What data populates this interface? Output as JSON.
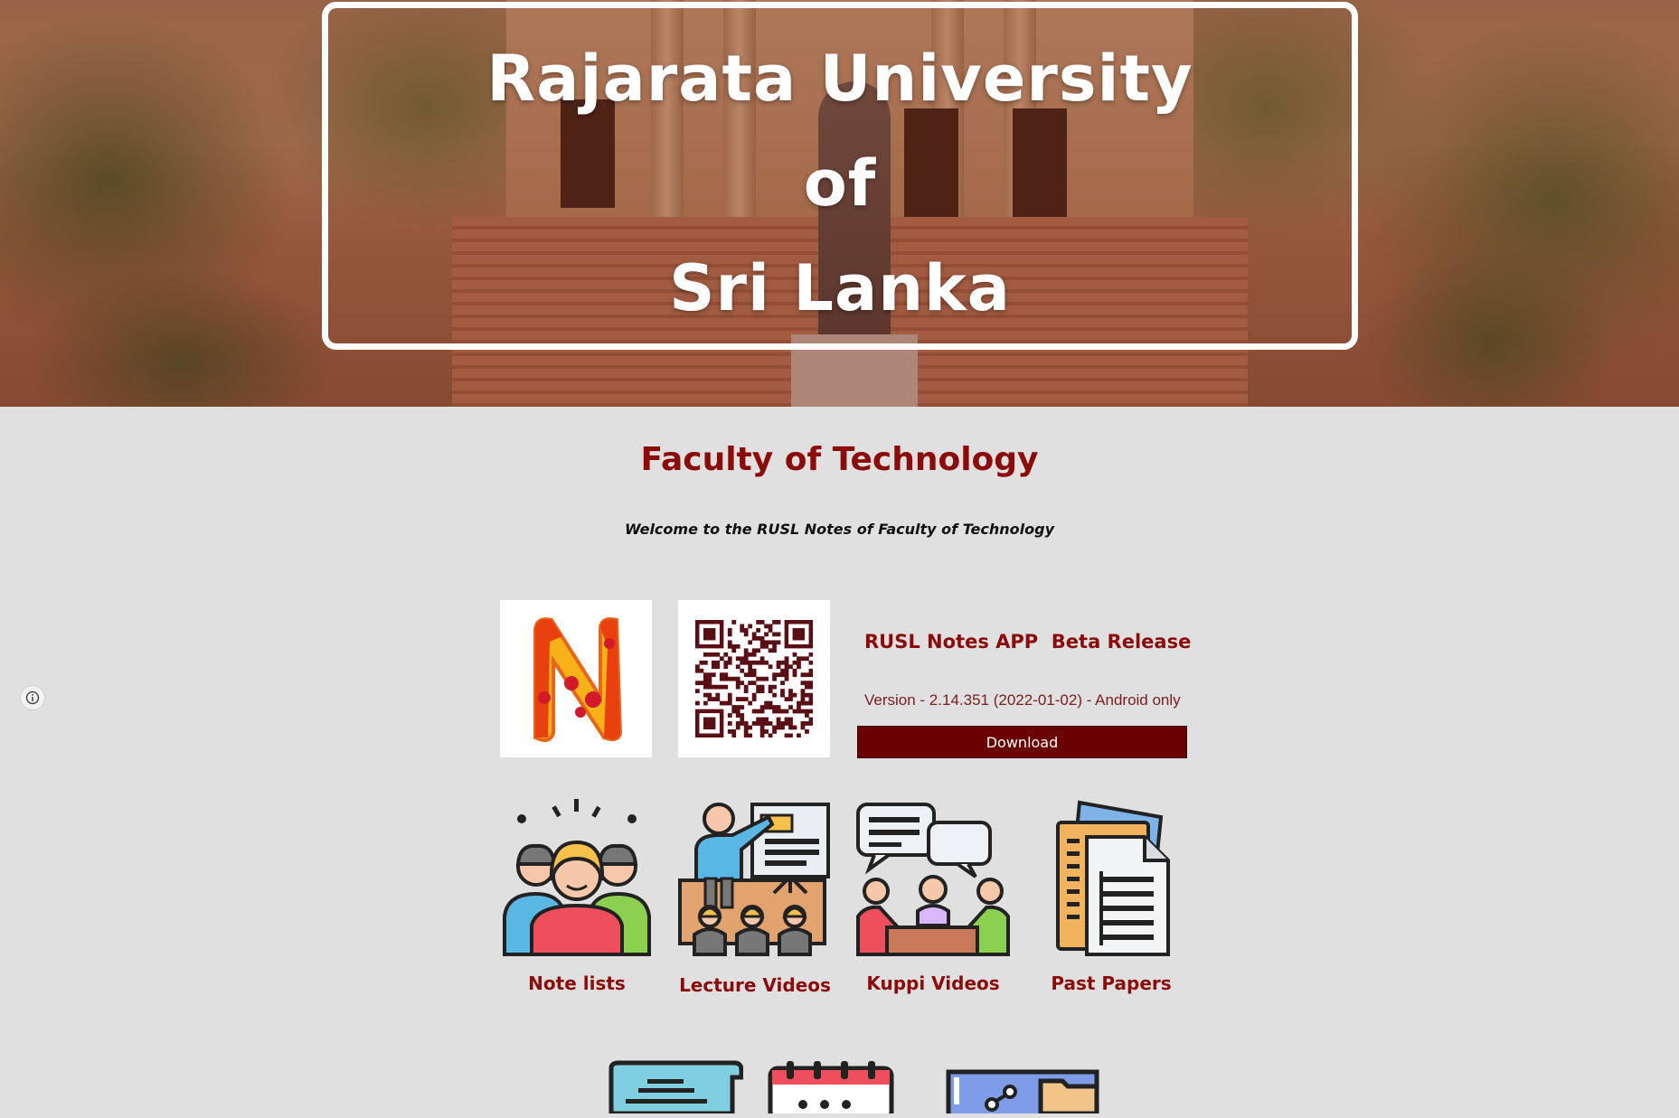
{
  "hero": {
    "title_lines": [
      "Rajarata University",
      "of",
      "Sri Lanka"
    ]
  },
  "main": {
    "faculty_title": "Faculty of Technology",
    "welcome_text": "Welcome to the RUSL Notes of Faculty of Technology"
  },
  "app": {
    "logo_letter": "N",
    "title": "RUSL Notes APP  Beta Release",
    "version": "Version - 2.14.351 (2022-01-02) - Android only",
    "download_label": "Download"
  },
  "tiles": [
    {
      "label": "Note lists",
      "icon": "group-people-icon"
    },
    {
      "label": "Lecture Videos",
      "icon": "lecture-presentation-icon"
    },
    {
      "label": "Kuppi Videos",
      "icon": "discussion-chat-icon"
    },
    {
      "label": "Past Papers",
      "icon": "documents-icon"
    }
  ],
  "bottom_icons": [
    "scroll-notice-icon",
    "calendar-icon",
    "shared-folder-icon"
  ],
  "colors": {
    "accent": "#8b0a0a",
    "button": "#6a0000",
    "page_bg": "#e0e0e0"
  }
}
